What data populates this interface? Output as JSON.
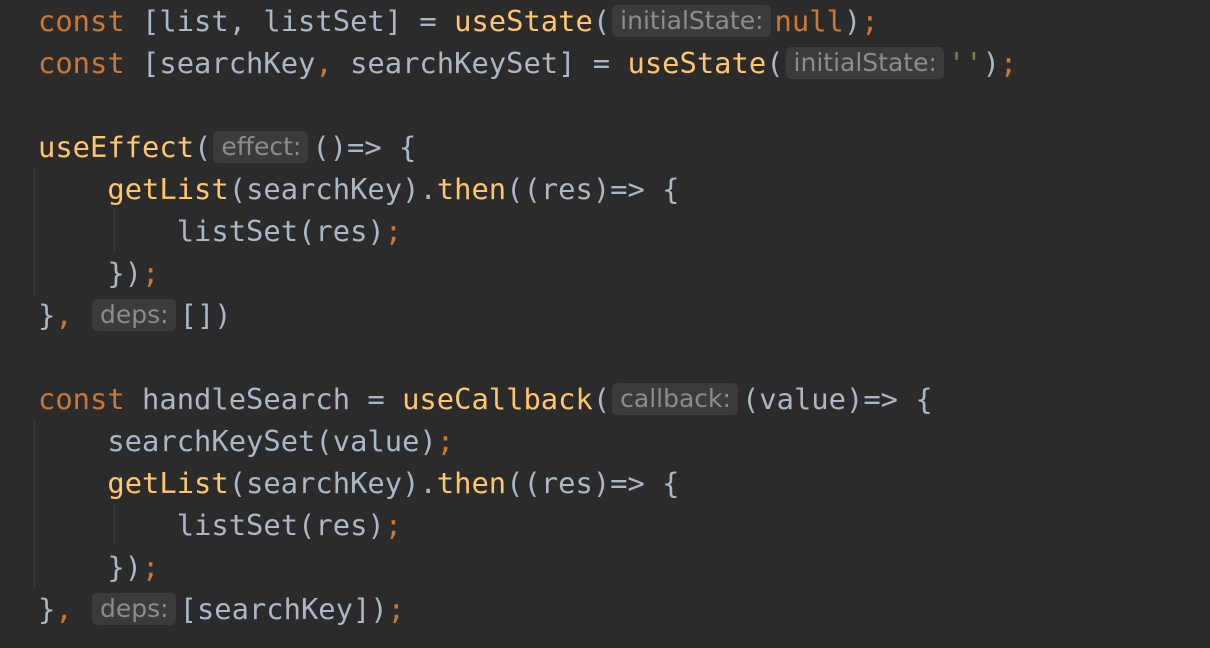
{
  "editor": {
    "colors": {
      "background": "#2b2b2b",
      "keyword": "#cc7832",
      "function": "#ffc66d",
      "plain": "#a9b7c6",
      "string": "#6a8759",
      "hint_text": "#8c8c8c",
      "hint_bg": "#3b3b3b"
    },
    "lines": [
      {
        "tokens": [
          {
            "t": "const",
            "c": "kw"
          },
          {
            "t": " [list, listSet] = ",
            "c": "pl"
          },
          {
            "t": "useState",
            "c": "fn"
          },
          {
            "t": "(",
            "c": "pl"
          },
          {
            "t": "initialState:",
            "c": "hint"
          },
          {
            "t": "null",
            "c": "kw"
          },
          {
            "t": ")",
            "c": "pl"
          },
          {
            "t": ";",
            "c": "punc"
          }
        ]
      },
      {
        "tokens": [
          {
            "t": "const",
            "c": "kw"
          },
          {
            "t": " [searchKey",
            "c": "pl"
          },
          {
            "t": ",",
            "c": "punc"
          },
          {
            "t": " searchKeySet] = ",
            "c": "pl"
          },
          {
            "t": "useState",
            "c": "fn"
          },
          {
            "t": "(",
            "c": "pl"
          },
          {
            "t": "initialState:",
            "c": "hint"
          },
          {
            "t": "''",
            "c": "str"
          },
          {
            "t": ")",
            "c": "pl"
          },
          {
            "t": ";",
            "c": "punc"
          }
        ]
      },
      {
        "tokens": []
      },
      {
        "tokens": [
          {
            "t": "useEffect",
            "c": "fn"
          },
          {
            "t": "(",
            "c": "pl"
          },
          {
            "t": "effect:",
            "c": "hint"
          },
          {
            "t": "()=> {",
            "c": "pl"
          }
        ]
      },
      {
        "tokens": [
          {
            "t": "    ",
            "c": "pl"
          },
          {
            "t": "getList",
            "c": "fn"
          },
          {
            "t": "(searchKey).",
            "c": "pl"
          },
          {
            "t": "then",
            "c": "fn"
          },
          {
            "t": "((res)=> {",
            "c": "pl"
          }
        ]
      },
      {
        "tokens": [
          {
            "t": "        listSet(res)",
            "c": "pl"
          },
          {
            "t": ";",
            "c": "punc"
          }
        ]
      },
      {
        "tokens": [
          {
            "t": "    })",
            "c": "pl"
          },
          {
            "t": ";",
            "c": "punc"
          }
        ]
      },
      {
        "tokens": [
          {
            "t": "}",
            "c": "pl"
          },
          {
            "t": ",",
            "c": "punc"
          },
          {
            "t": " ",
            "c": "pl"
          },
          {
            "t": "deps:",
            "c": "hint"
          },
          {
            "t": "[])",
            "c": "pl"
          }
        ]
      },
      {
        "tokens": []
      },
      {
        "tokens": [
          {
            "t": "const",
            "c": "kw"
          },
          {
            "t": " handleSearch = ",
            "c": "pl"
          },
          {
            "t": "useCallback",
            "c": "fn"
          },
          {
            "t": "(",
            "c": "pl"
          },
          {
            "t": "callback:",
            "c": "hint"
          },
          {
            "t": "(value)=> {",
            "c": "pl"
          }
        ]
      },
      {
        "tokens": [
          {
            "t": "    searchKeySet(value)",
            "c": "pl"
          },
          {
            "t": ";",
            "c": "punc"
          }
        ]
      },
      {
        "tokens": [
          {
            "t": "    ",
            "c": "pl"
          },
          {
            "t": "getList",
            "c": "fn"
          },
          {
            "t": "(searchKey).",
            "c": "pl"
          },
          {
            "t": "then",
            "c": "fn"
          },
          {
            "t": "((res)=> {",
            "c": "pl"
          }
        ]
      },
      {
        "tokens": [
          {
            "t": "        listSet(res)",
            "c": "pl"
          },
          {
            "t": ";",
            "c": "punc"
          }
        ]
      },
      {
        "tokens": [
          {
            "t": "    })",
            "c": "pl"
          },
          {
            "t": ";",
            "c": "punc"
          }
        ]
      },
      {
        "tokens": [
          {
            "t": "}",
            "c": "pl"
          },
          {
            "t": ",",
            "c": "punc"
          },
          {
            "t": " ",
            "c": "pl"
          },
          {
            "t": "deps:",
            "c": "hint"
          },
          {
            "t": "[searchKey])",
            "c": "pl"
          },
          {
            "t": ";",
            "c": "punc"
          }
        ]
      }
    ]
  }
}
